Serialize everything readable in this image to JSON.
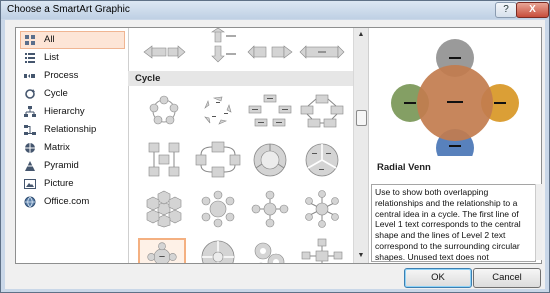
{
  "window": {
    "title": "Choose a SmartArt Graphic",
    "help_label": "?",
    "close_label": "X"
  },
  "categories": [
    {
      "label": "All",
      "icon": "all-grid-icon",
      "selected": true
    },
    {
      "label": "List",
      "icon": "list-icon"
    },
    {
      "label": "Process",
      "icon": "process-icon"
    },
    {
      "label": "Cycle",
      "icon": "cycle-icon"
    },
    {
      "label": "Hierarchy",
      "icon": "hierarchy-icon"
    },
    {
      "label": "Relationship",
      "icon": "relationship-icon"
    },
    {
      "label": "Matrix",
      "icon": "matrix-icon"
    },
    {
      "label": "Pyramid",
      "icon": "pyramid-icon"
    },
    {
      "label": "Picture",
      "icon": "picture-icon"
    },
    {
      "label": "Office.com",
      "icon": "globe-icon"
    }
  ],
  "gallery": {
    "section_header": "Cycle"
  },
  "preview": {
    "title": "Radial Venn",
    "description": "Use to show both overlapping relationships and the relationship to a central idea in a cycle. The first line of Level 1 text corresponds to the central shape and the lines of Level 2 text correspond to the surrounding circular shapes. Unused text does not",
    "colors": {
      "center": "#c27c4e",
      "top": "#8f8f8f",
      "left": "#7d9a5c",
      "right": "#d99a2b",
      "bottom": "#4f7ab8"
    }
  },
  "buttons": {
    "ok": "OK",
    "cancel": "Cancel"
  }
}
